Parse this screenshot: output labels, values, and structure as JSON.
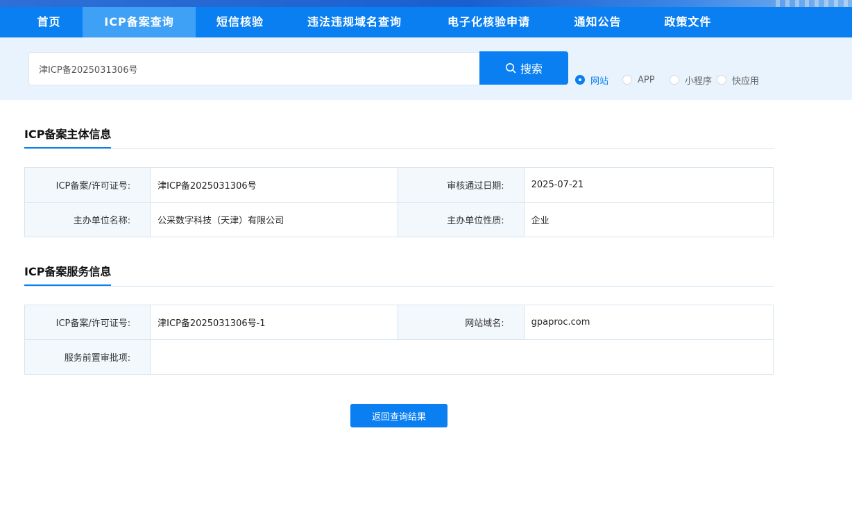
{
  "nav": {
    "items": [
      {
        "label": "首页"
      },
      {
        "label": "ICP备案查询"
      },
      {
        "label": "短信核验"
      },
      {
        "label": "违法违规域名查询"
      },
      {
        "label": "电子化核验申请"
      },
      {
        "label": "通知公告"
      },
      {
        "label": "政策文件"
      }
    ],
    "active_label": "ICP备案查询"
  },
  "search": {
    "value": "津ICP备2025031306号",
    "button_label": "搜索",
    "options": [
      "网站",
      "APP",
      "小程序",
      "快应用"
    ],
    "selected": "网站"
  },
  "subject_section": {
    "title": "ICP备案主体信息",
    "rows": [
      {
        "k1": "ICP备案/许可证号:",
        "v1": "津ICP备2025031306号",
        "k2": "审核通过日期:",
        "v2": "2025-07-21"
      },
      {
        "k1": "主办单位名称:",
        "v1": "公采数字科技（天津）有限公司",
        "k2": "主办单位性质:",
        "v2": "企业"
      }
    ]
  },
  "service_section": {
    "title": "ICP备案服务信息",
    "row1": {
      "k1": "ICP备案/许可证号:",
      "v1": "津ICP备2025031306号-1",
      "k2": "网站域名:",
      "v2": "gpaproc.com"
    },
    "row2": {
      "k1": "服务前置审批项:",
      "v1": ""
    }
  },
  "back_button_label": "返回查询结果",
  "colors": {
    "primary": "#0a7ff2",
    "nav_active": "#3ea1f6",
    "band": "#e8f3fd",
    "key_cell": "#f3f8fd"
  }
}
